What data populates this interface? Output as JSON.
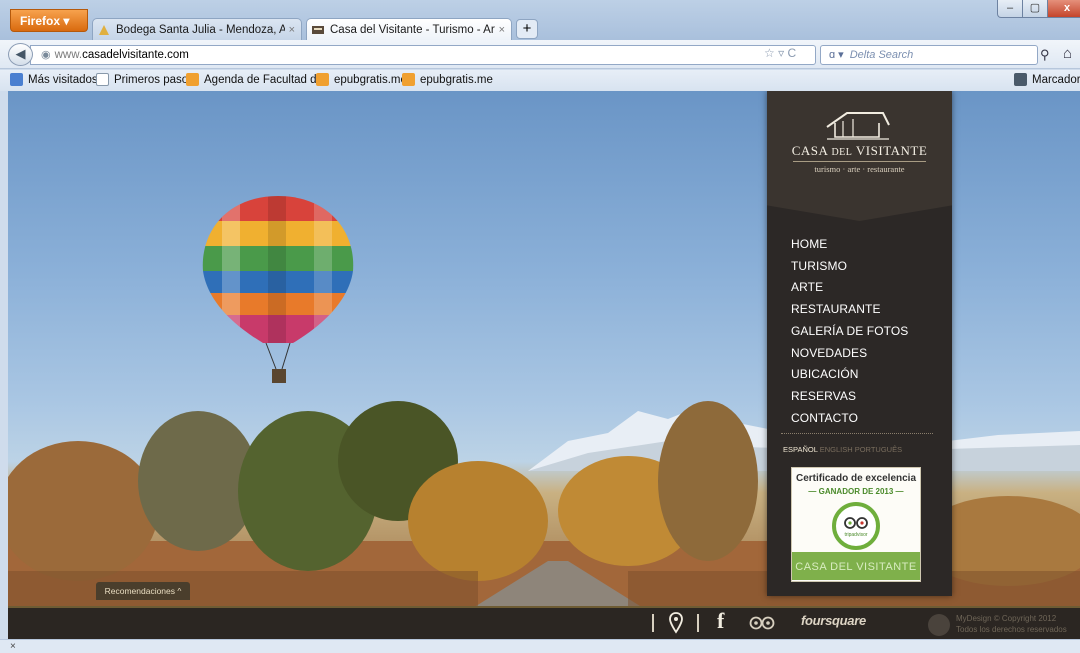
{
  "browser": {
    "menu_button": "Firefox",
    "tabs": [
      {
        "title": "Bodega Santa Julia - Mendoza, Argen...",
        "active": false
      },
      {
        "title": "Casa del Visitante - Turismo - Arte - R...",
        "active": true
      }
    ],
    "new_tab": "+",
    "url_host_prefix": "www.",
    "url_host": "casadelvisitante.com",
    "search_engine": "Delta Search",
    "window_buttons": {
      "minimize": "–",
      "maximize": "▢",
      "close": "x"
    }
  },
  "bookmarks": [
    {
      "label": "Más visitados",
      "icon": "blue-bookmark-icon"
    },
    {
      "label": "Primeros pasos",
      "icon": "page-icon"
    },
    {
      "label": "Agenda de Facultad d...",
      "icon": "rss-icon"
    },
    {
      "label": "epubgratis.me",
      "icon": "rss-icon"
    },
    {
      "label": "epubgratis.me",
      "icon": "rss-icon"
    },
    {
      "label": "Marcadores",
      "icon": "bookmarks-menu-icon"
    }
  ],
  "site": {
    "brand": {
      "name_a": "CASA ",
      "name_b": "DEL",
      "name_c": " VISITANTE",
      "tagline": "turismo · arte · restaurante"
    },
    "menu": [
      "HOME",
      "TURISMO",
      "ARTE",
      "RESTAURANTE",
      "GALERÍA DE FOTOS",
      "NOVEDADES",
      "UBICACIÓN",
      "RESERVAS",
      "CONTACTO"
    ],
    "languages": {
      "active": "ESPAÑOL",
      "others": [
        " ENGLISH",
        " PORTUGUÊS"
      ]
    },
    "certificate": {
      "title": "Certificado de excelencia",
      "subtitle": "— GANADOR DE 2013 —",
      "badge": "tripadvisor",
      "ribbon": "CASA DEL VISITANTE"
    },
    "recommendations_tab": "Recomendaciones ^",
    "footer": {
      "foursquare": "foursquare",
      "copyright_line1": "MyDesign © Copyright 2012",
      "copyright_line2": "Todos los derechos reservados"
    }
  },
  "statusbar": {
    "close": "×"
  },
  "colors": {
    "sidebar_bg": "#2c2826",
    "brand_bg": "#3a342f",
    "menu_text": "#ffffff",
    "certificate_green": "#7fb04b",
    "footer_bg": "#2b2622"
  }
}
